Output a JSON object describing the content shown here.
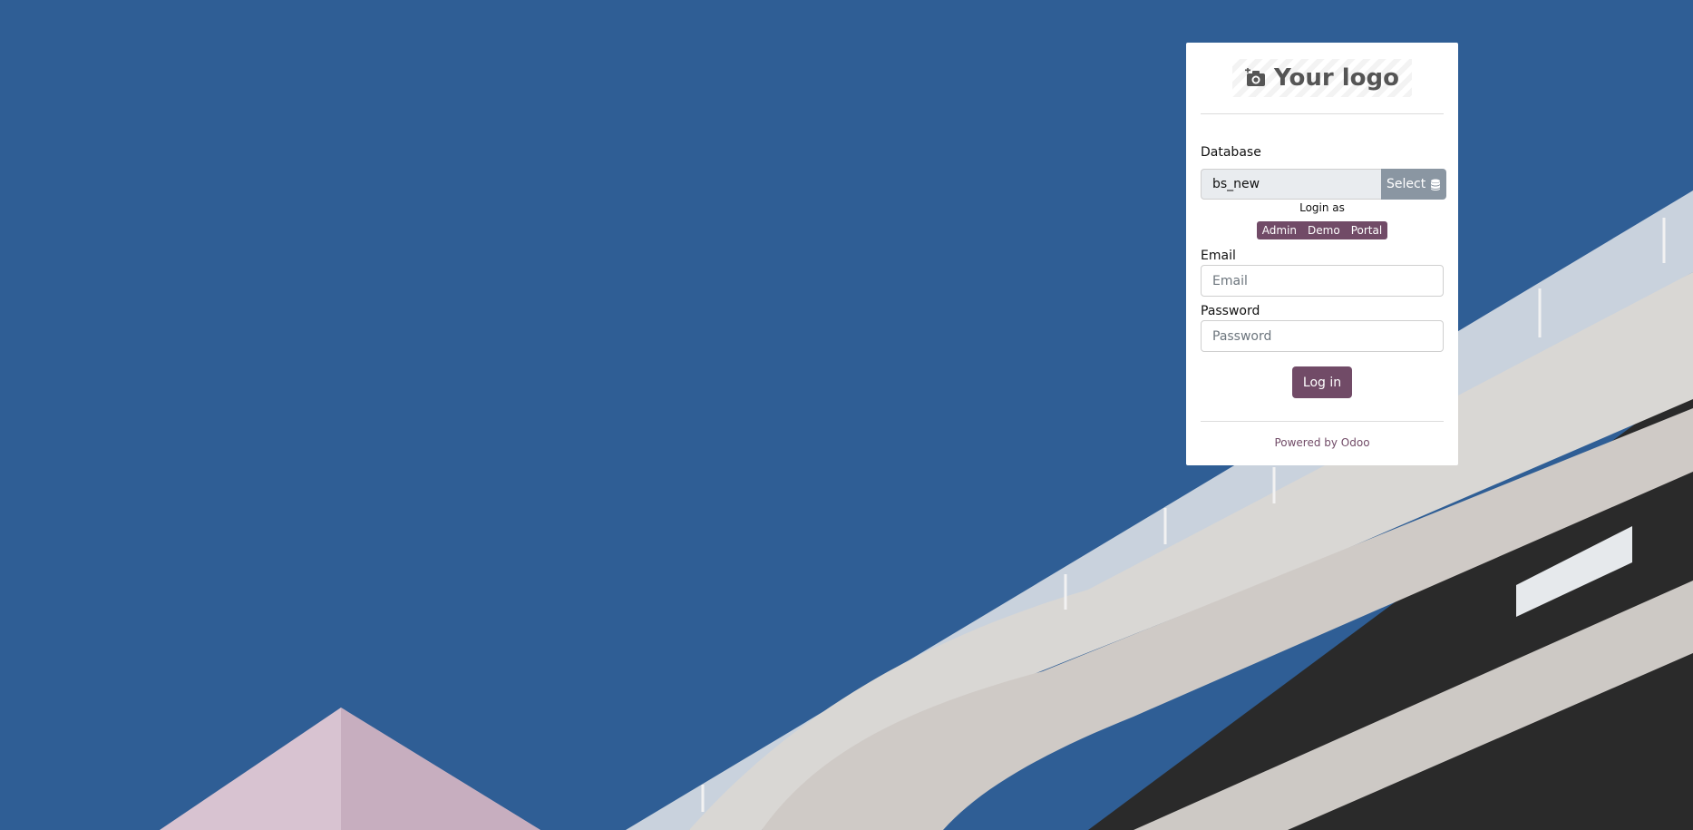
{
  "logo": {
    "text": "Your logo",
    "icon": "camera-plus-icon"
  },
  "database": {
    "label": "Database",
    "value": "bs_new",
    "select_label": "Select",
    "select_icon": "database-icon"
  },
  "login_as": {
    "label": "Login as",
    "roles": [
      "Admin",
      "Demo",
      "Portal"
    ]
  },
  "email": {
    "label": "Email",
    "placeholder": "Email"
  },
  "password": {
    "label": "Password",
    "placeholder": "Password"
  },
  "login_button": "Log in",
  "footer": {
    "powered_by": "Powered by Odoo"
  },
  "colors": {
    "background_blue": "#2f5e95",
    "brand_purple": "#714b67",
    "select_gray": "#8a96a2"
  }
}
